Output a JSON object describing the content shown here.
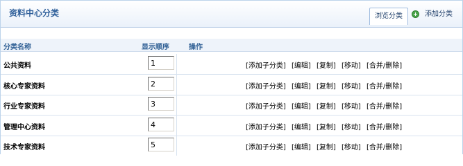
{
  "header": {
    "title": "资料中心分类",
    "tabs": [
      {
        "label": "浏览分类"
      },
      {
        "label": "添加分类"
      }
    ]
  },
  "table": {
    "columns": [
      "分类名称",
      "显示顺序",
      "操作"
    ],
    "rows": [
      {
        "name": "公共资料",
        "order": "1"
      },
      {
        "name": "核心专家资料",
        "order": "2"
      },
      {
        "name": "行业专家资料",
        "order": "3"
      },
      {
        "name": "管理中心资料",
        "order": "4"
      },
      {
        "name": "技术专家资料",
        "order": "5"
      }
    ],
    "actions": [
      "[添加子分类]",
      "[编辑]",
      "[复制]",
      "[移动]",
      "[合并/删除]"
    ]
  }
}
